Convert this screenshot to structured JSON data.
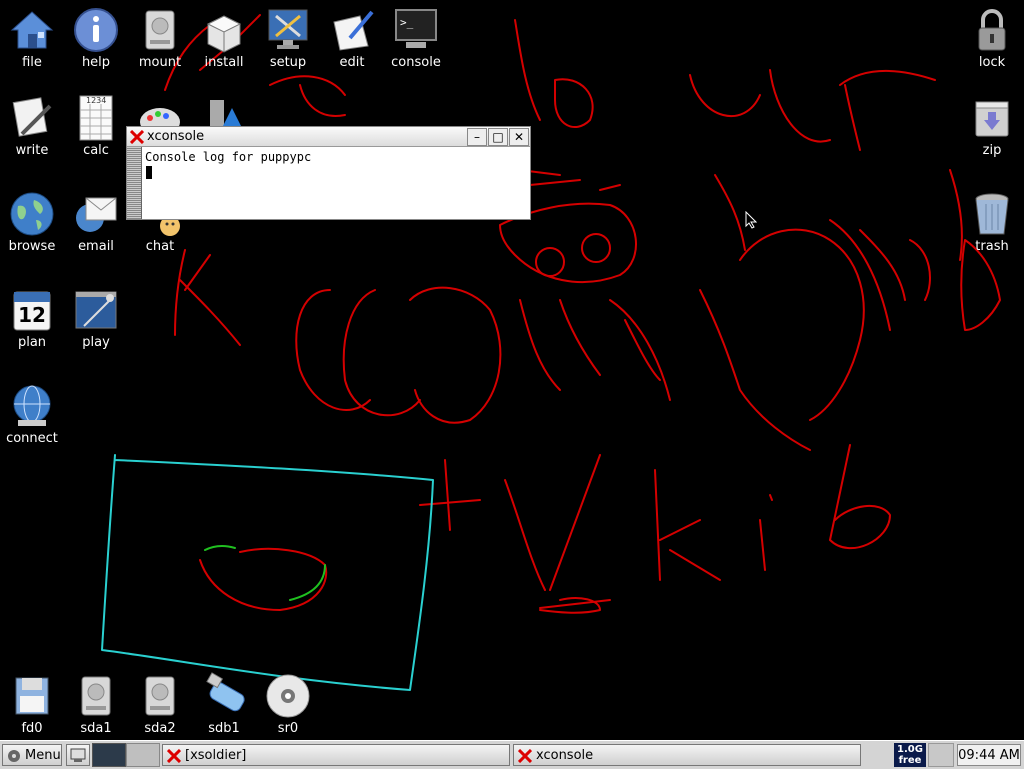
{
  "desktop": {
    "icons": {
      "file": "file",
      "help": "help",
      "mount": "mount",
      "install": "install",
      "setup": "setup",
      "edit": "edit",
      "console": "console",
      "lock": "lock",
      "write": "write",
      "calc": "calc",
      "zip": "zip",
      "browse": "browse",
      "email": "email",
      "chat": "chat",
      "trash": "trash",
      "plan": "plan",
      "play": "play",
      "connect": "connect",
      "fd0": "fd0",
      "sda1": "sda1",
      "sda2": "sda2",
      "sdb1": "sdb1",
      "sr0": "sr0"
    },
    "plan_day": "12",
    "calc_header": "1234"
  },
  "xconsole": {
    "title": "xconsole",
    "log_text": "Console log for puppypc"
  },
  "taskbar": {
    "menu_label": "Menu",
    "tasks": [
      "[xsoldier]",
      "xconsole"
    ],
    "mem_value": "1.0G",
    "mem_label": "free",
    "clock": "09:44 AM"
  },
  "colors": {
    "desktop_bg": "#000000",
    "scribble_red": "#d40000",
    "scribble_cyan": "#2ad0d0",
    "scribble_green": "#20c020"
  }
}
